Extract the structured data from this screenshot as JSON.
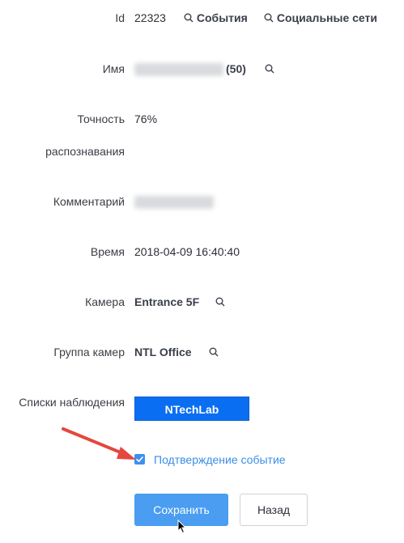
{
  "fields": {
    "id": {
      "label": "Id",
      "value": "22323"
    },
    "events_link": "События",
    "social_link": "Социальные сети",
    "name": {
      "label": "Имя",
      "count": "(50)"
    },
    "accuracy": {
      "label_line1": "Точность",
      "label_line2": "распознавания",
      "value": "76%"
    },
    "comment": {
      "label": "Комментарий"
    },
    "time": {
      "label": "Время",
      "value": "2018-04-09 16:40:40"
    },
    "camera": {
      "label": "Камера",
      "value": "Entrance 5F"
    },
    "camera_group": {
      "label": "Группа камер",
      "value": "NTL Office"
    },
    "watchlists": {
      "label": "Списки наблюдения",
      "value": "NTechLab"
    }
  },
  "confirm": {
    "label": "Подтверждение событие",
    "checked": true
  },
  "buttons": {
    "save": "Сохранить",
    "back": "Назад"
  },
  "colors": {
    "watchlist_bg": "#0a6ef2",
    "primary_button": "#4a9df0",
    "checkbox": "#3f8ff0",
    "link_blue": "#3a8ee6",
    "annotation_arrow": "#e5473e"
  },
  "icons": [
    "search-icon",
    "checkbox-check-icon",
    "annotation-arrow",
    "mouse-cursor-icon"
  ]
}
